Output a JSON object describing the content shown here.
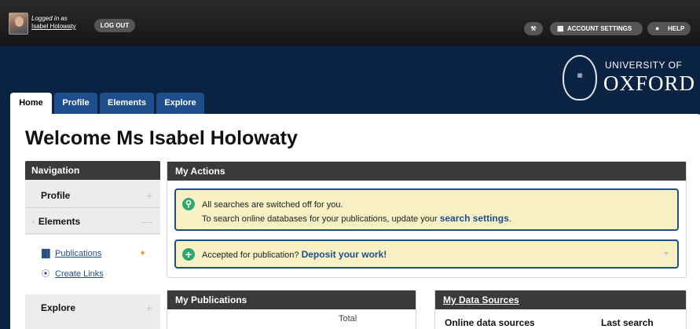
{
  "topbar": {
    "logged_in_prefix": "Logged in as",
    "user_name": "Isabel Holowaty",
    "logout_label": "LOG OUT",
    "account_settings_label": "ACCOUNT SETTINGS",
    "help_label": "HELP",
    "icons": [
      "wrench-icon",
      "grid-icon",
      "speech-bubble-icon"
    ]
  },
  "logo": {
    "line1": "UNIVERSITY OF",
    "line2": "OXFORD",
    "seal_glyph": "▦"
  },
  "tabs": [
    {
      "label": "Home",
      "active": true
    },
    {
      "label": "Profile",
      "active": false
    },
    {
      "label": "Elements",
      "active": false
    },
    {
      "label": "Explore",
      "active": false
    }
  ],
  "page_title": "Welcome Ms Isabel Holowaty",
  "navigation": {
    "title": "Navigation",
    "profile": "Profile",
    "elements": "Elements",
    "publications": "Publications",
    "create_links": "Create Links",
    "explore": "Explore"
  },
  "actions": {
    "title": "My Actions",
    "notice1_line1": "All searches are switched off for you.",
    "notice1_line2_prefix": "To search online databases for your publications, update your ",
    "notice1_link": "search settings",
    "notice1_suffix": ".",
    "notice2_prefix": "Accepted for publication? ",
    "notice2_link": "Deposit your work!"
  },
  "publications_panel": {
    "title": "My Publications",
    "col_total": "Total"
  },
  "data_sources": {
    "title": "My Data Sources",
    "col_online": "Online data sources",
    "col_last": "Last search"
  },
  "colors": {
    "navy": "#0b2343",
    "tab_blue": "#1f4e8c",
    "panel_header": "#3a3a3a",
    "notice_bg": "#f6f0c4",
    "notice_border": "#1f4e8c",
    "accent_green": "#33a86d",
    "star_orange": "#f0a020"
  }
}
